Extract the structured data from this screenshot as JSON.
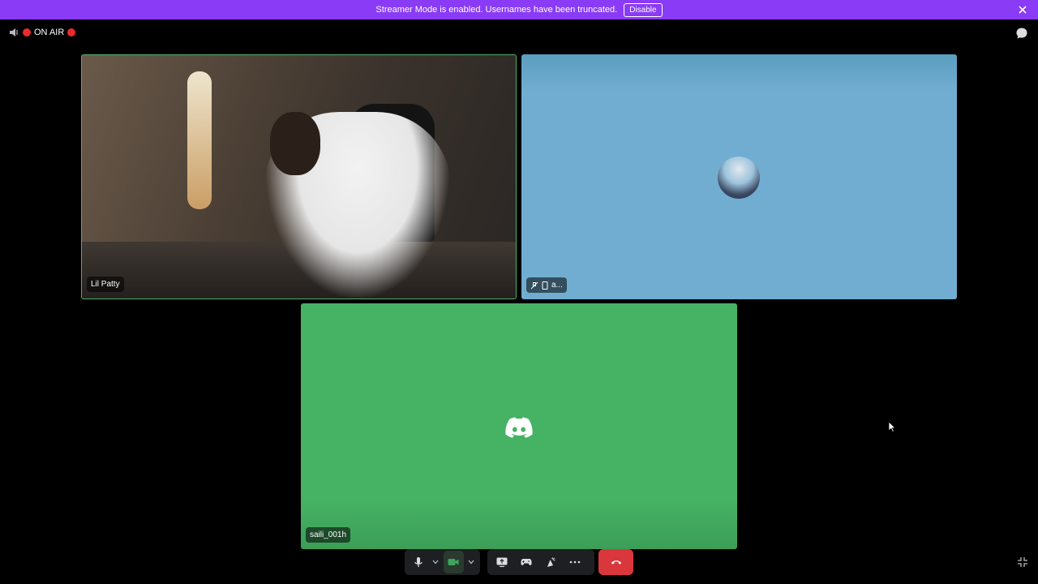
{
  "banner": {
    "message": "Streamer Mode is enabled. Usernames have been truncated.",
    "disable_label": "Disable",
    "color": "#8a3bf6"
  },
  "status": {
    "on_air_label": "ON AIR"
  },
  "tiles": [
    {
      "name": "Lil Patty",
      "type": "video"
    },
    {
      "name": "a...",
      "type": "avatar",
      "background": "#71add0"
    },
    {
      "name": "saili_001h",
      "type": "discord-logo",
      "background": "#46b264"
    }
  ],
  "controls": {
    "items": [
      "microphone-icon",
      "chevron-down-icon",
      "camera-icon",
      "chevron-down-icon",
      "screen-share-icon",
      "activity-icon",
      "soundboard-icon",
      "more-icon"
    ],
    "hangup_color": "#da373c"
  }
}
